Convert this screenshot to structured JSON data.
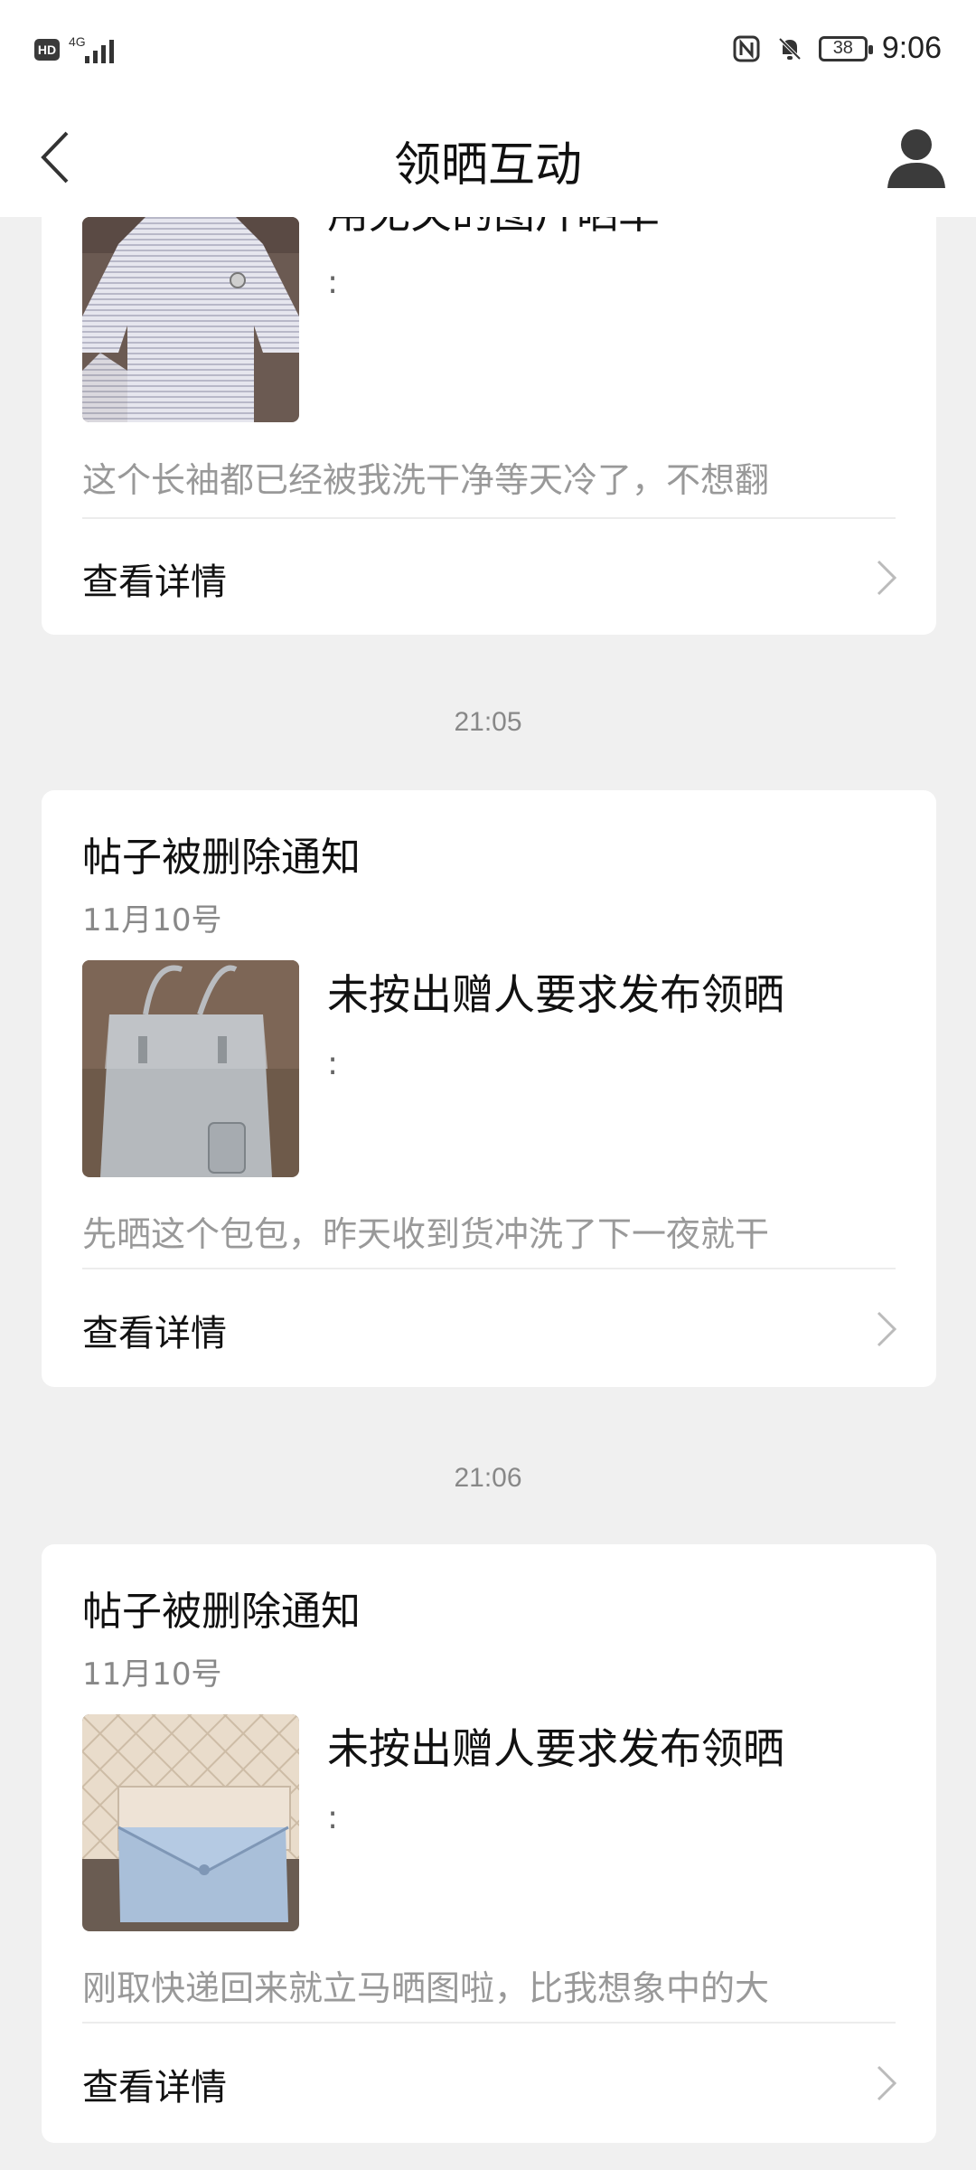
{
  "status_bar": {
    "hd": "HD",
    "network": "4G",
    "battery": "38",
    "time": "9:06"
  },
  "header": {
    "title": "领晒互动"
  },
  "timestamps": [
    "21:05",
    "21:06"
  ],
  "cards": [
    {
      "title": "",
      "date": "",
      "reason": "用无关的图片晒单",
      "colon": ":",
      "excerpt": "这个长袖都已经被我洗干净等天冷了，不想翻",
      "detail_label": "查看详情",
      "thumb": "striped-longsleeve-photo"
    },
    {
      "title": "帖子被删除通知",
      "date": "11月10号",
      "reason": "未按出赠人要求发布领晒",
      "colon": ":",
      "excerpt": "先晒这个包包，昨天收到货冲洗了下一夜就干",
      "detail_label": "查看详情",
      "thumb": "silver-handbag-photo"
    },
    {
      "title": "帖子被删除通知",
      "date": "11月10号",
      "reason": "未按出赠人要求发布领晒",
      "colon": ":",
      "excerpt": "刚取快递回来就立马晒图啦，比我想象中的大",
      "detail_label": "查看详情",
      "thumb": "quilted-bag-and-wallet-photo"
    }
  ]
}
